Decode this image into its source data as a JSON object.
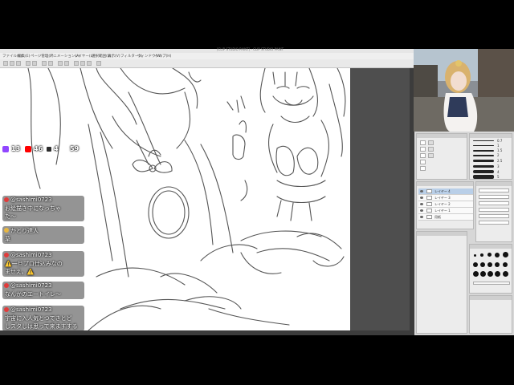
{
  "window": {
    "title": "[CLIP STUDIO PAINT] - CLIP STUDIO PAINT"
  },
  "menu": [
    "ファイル(F)",
    "編集(E)",
    "ページ管理(P)",
    "アニメーション(A)",
    "レイヤー(L)",
    "選択範囲(S)",
    "表示(V)",
    "フィルター(I)",
    "ウィンドウ(W)",
    "ヘルプ(H)"
  ],
  "stream": {
    "stats": [
      {
        "icon": "twitch-icon",
        "color": "#9146ff",
        "count": "13"
      },
      {
        "icon": "youtube-icon",
        "color": "#ff0000",
        "count": "46"
      },
      {
        "icon": "viewer-icon",
        "color": "#2c2c2c",
        "count": "4"
      },
      {
        "icon": "user-icon",
        "color": "#ffffff",
        "count": "59"
      }
    ],
    "chat": [
      {
        "user": "@sashimi0723",
        "lines": [
          "お絵描き中になっちゃ",
          "た〜"
        ]
      },
      {
        "user": "かとり達人",
        "lines": [
          "草"
        ]
      },
      {
        "user": "@sashimi0723",
        "lines": [
          "⚠️一旦プロ仕込みなの",
          "ませえ。⚠️"
        ]
      },
      {
        "user": "@sashimi0723",
        "lines": [
          "なんかのエートイレ〜"
        ]
      },
      {
        "user": "@sashimi0723",
        "lines": [
          "宇宙に入人気とつてきとど",
          "しスタしは思って来ますする"
        ]
      }
    ]
  },
  "brush": {
    "sizes": [
      "0.7",
      "1",
      "1.5",
      "2",
      "2.5",
      "3",
      "4",
      "5"
    ]
  },
  "layers": [
    {
      "name": "レイヤー 4",
      "selected": true
    },
    {
      "name": "レイヤー 3",
      "selected": false
    },
    {
      "name": "レイヤー 2",
      "selected": false
    },
    {
      "name": "レイヤー 1",
      "selected": false
    },
    {
      "name": "用紙",
      "selected": false
    }
  ],
  "colors": {
    "accent_selection": "#b9cfe8",
    "canvas": "#ffffff"
  }
}
